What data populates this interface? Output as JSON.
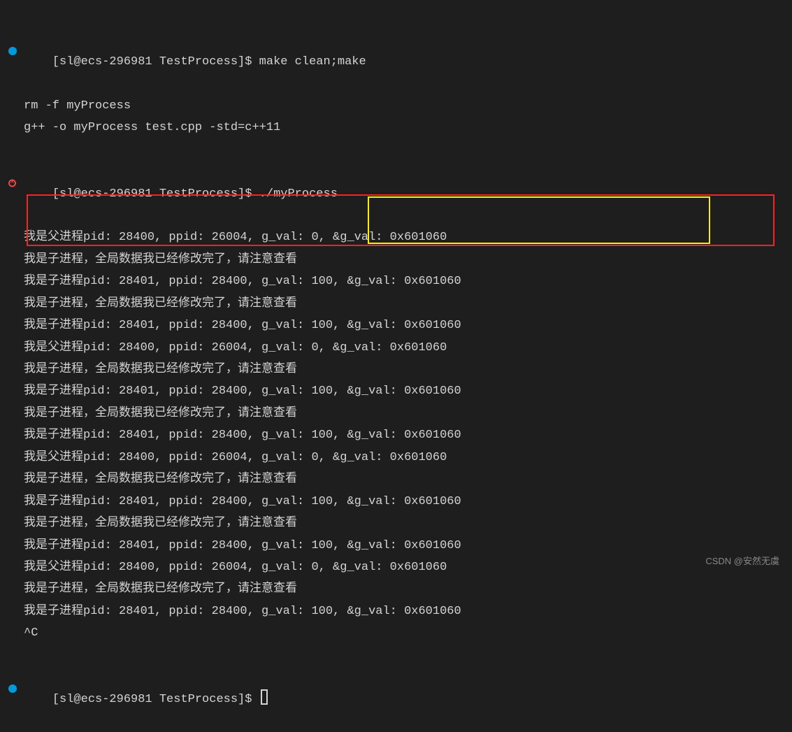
{
  "prompt": {
    "user": "sl",
    "host": "ecs-296981",
    "cwd": "TestProcess",
    "full": "[sl@ecs-296981 TestProcess]$ "
  },
  "commands": {
    "c1": "make clean;make",
    "c2": "./myProcess",
    "c3": ""
  },
  "output": {
    "l1": "rm -f myProcess",
    "l2": "g++ -o myProcess test.cpp -std=c++11",
    "l3": "我是父进程pid: 28400, ppid: 26004, g_val: 0, &g_val: 0x601060",
    "l4": "我是子进程，全局数据我已经修改完了，请注意查看",
    "l5": "我是子进程pid: 28401, ppid: 28400, g_val: 100, &g_val: 0x601060",
    "l6": "我是子进程，全局数据我已经修改完了，请注意查看",
    "l7": "我是子进程pid: 28401, ppid: 28400, g_val: 100, &g_val: 0x601060",
    "l8": "我是父进程pid: 28400, ppid: 26004, g_val: 0, &g_val: 0x601060",
    "l9": "我是子进程，全局数据我已经修改完了，请注意查看",
    "l10": "我是子进程pid: 28401, ppid: 28400, g_val: 100, &g_val: 0x601060",
    "l11": "我是子进程，全局数据我已经修改完了，请注意查看",
    "l12": "我是子进程pid: 28401, ppid: 28400, g_val: 100, &g_val: 0x601060",
    "l13": "我是父进程pid: 28400, ppid: 26004, g_val: 0, &g_val: 0x601060",
    "l14": "我是子进程，全局数据我已经修改完了，请注意查看",
    "l15": "我是子进程pid: 28401, ppid: 28400, g_val: 100, &g_val: 0x601060",
    "l16": "我是子进程，全局数据我已经修改完了，请注意查看",
    "l17": "我是子进程pid: 28401, ppid: 28400, g_val: 100, &g_val: 0x601060",
    "l18": "我是父进程pid: 28400, ppid: 26004, g_val: 0, &g_val: 0x601060",
    "l19": "我是子进程，全局数据我已经修改完了，请注意查看",
    "l20": "我是子进程pid: 28401, ppid: 28400, g_val: 100, &g_val: 0x601060",
    "l21": "^C"
  },
  "watermark": "CSDN @安然无虞"
}
